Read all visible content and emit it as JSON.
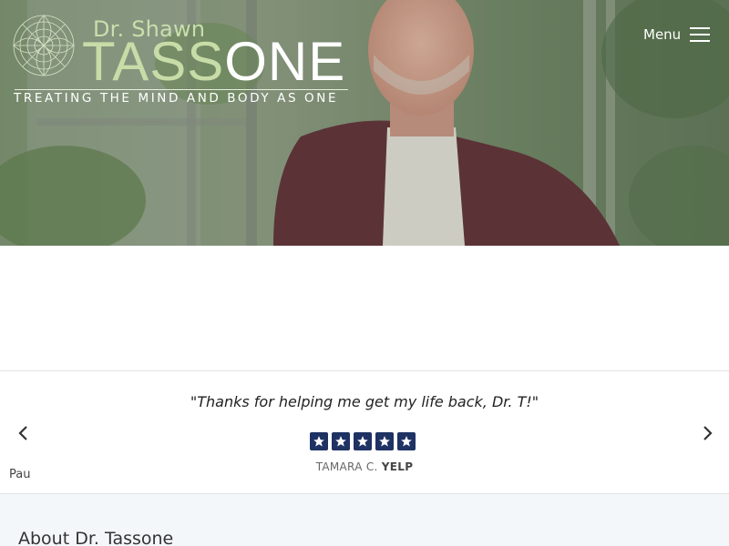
{
  "header": {
    "logo": {
      "prefix": "Dr. Shawn",
      "name_part1": "TASS",
      "name_part2": "ONE",
      "tagline": "TREATING THE MIND AND BODY AS ONE"
    },
    "menu_label": "Menu"
  },
  "testimonial": {
    "quote": "\"Thanks for helping me get my life back, Dr. T!\"",
    "rating": 5,
    "reviewer": "TAMARA C.",
    "source": "YELP",
    "pause_label": "Pau"
  },
  "about": {
    "title": "About Dr. Tassone"
  },
  "colors": {
    "star_bg": "#1f3264",
    "logo_green": "#c7dca7",
    "about_bg": "#f4f7fa"
  },
  "icons": [
    "logo-mandala-icon",
    "hamburger-icon",
    "star-icon",
    "chevron-left-icon",
    "chevron-right-icon"
  ]
}
